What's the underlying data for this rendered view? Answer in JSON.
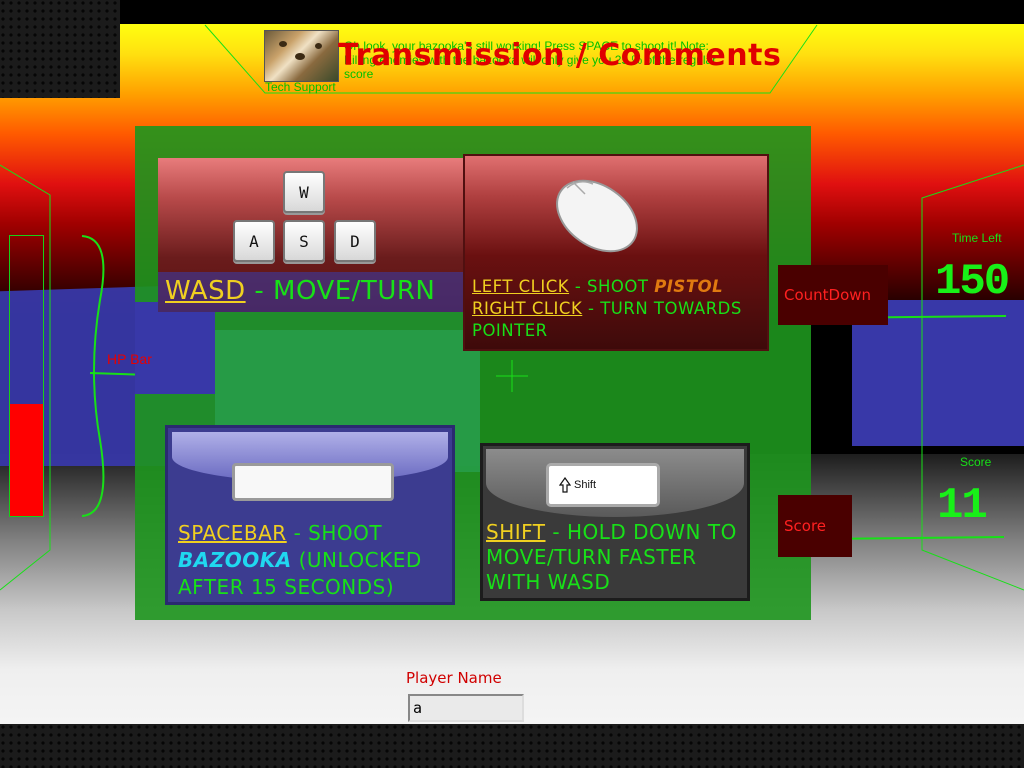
{
  "transmission": {
    "title": "Transmission / Comments",
    "message": "Oh look, your bazooka's still working! Press SPACE to shoot it! Note: Killing enemies with the bazooka will only give you 25 % of the regular score",
    "sender": "Tech Support"
  },
  "instructions": {
    "wasd": {
      "keys": [
        "W",
        "A",
        "S",
        "D"
      ],
      "key_label": "WASD",
      "action": " - MOVE/TURN"
    },
    "mouse": {
      "left_key": "LEFT CLICK",
      "left_action": " - SHOOT ",
      "left_weapon": "PISTOL",
      "right_key": "RIGHT CLICK",
      "right_action": " - TURN TOWARDS POINTER"
    },
    "spacebar": {
      "key_label": "SPACEBAR",
      "action": " - SHOOT ",
      "weapon": "BAZOOKA",
      "note": " (UNLOCKED AFTER 15 SECONDS)"
    },
    "shift": {
      "key_cap": "Shift",
      "key_label": "SHIFT",
      "action": " - HOLD DOWN TO MOVE/TURN FASTER WITH WASD"
    }
  },
  "hud": {
    "hp_label": "HP Bar",
    "hp_fraction": 0.4,
    "countdown_tag": "CountDown",
    "time_left_label": "Time Left",
    "time_left_value": "150",
    "score_tag": "Score",
    "score_label": "Score",
    "score_value": "11"
  },
  "player": {
    "label": "Player Name",
    "value": "a"
  },
  "colors": {
    "hud_green": "#18e018",
    "hud_red": "#ff0000",
    "keyword_yellow": "#f0d020",
    "pistol_orange": "#e07a10",
    "bazooka_cyan": "#20d8f0"
  }
}
